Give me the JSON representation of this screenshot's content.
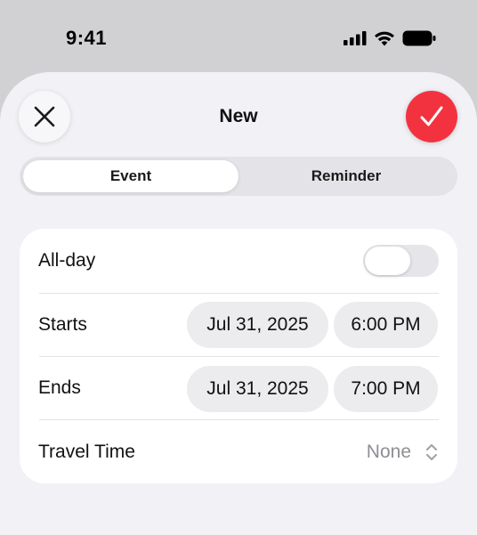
{
  "status_bar": {
    "time": "9:41",
    "icons": [
      "cellular-signal-icon",
      "wifi-icon",
      "battery-icon"
    ]
  },
  "sheet": {
    "title": "New",
    "close_icon": "xmark-icon",
    "confirm_icon": "checkmark-icon",
    "confirm_color": "#f2333f"
  },
  "segmented": {
    "options": [
      "Event",
      "Reminder"
    ],
    "selected": "Event"
  },
  "form": {
    "all_day": {
      "label": "All-day",
      "value": false
    },
    "starts": {
      "label": "Starts",
      "date": "Jul 31, 2025",
      "time": "6:00 PM"
    },
    "ends": {
      "label": "Ends",
      "date": "Jul 31, 2025",
      "time": "7:00 PM"
    },
    "travel_time": {
      "label": "Travel Time",
      "value": "None",
      "icon": "chevron-up-down-icon"
    }
  }
}
